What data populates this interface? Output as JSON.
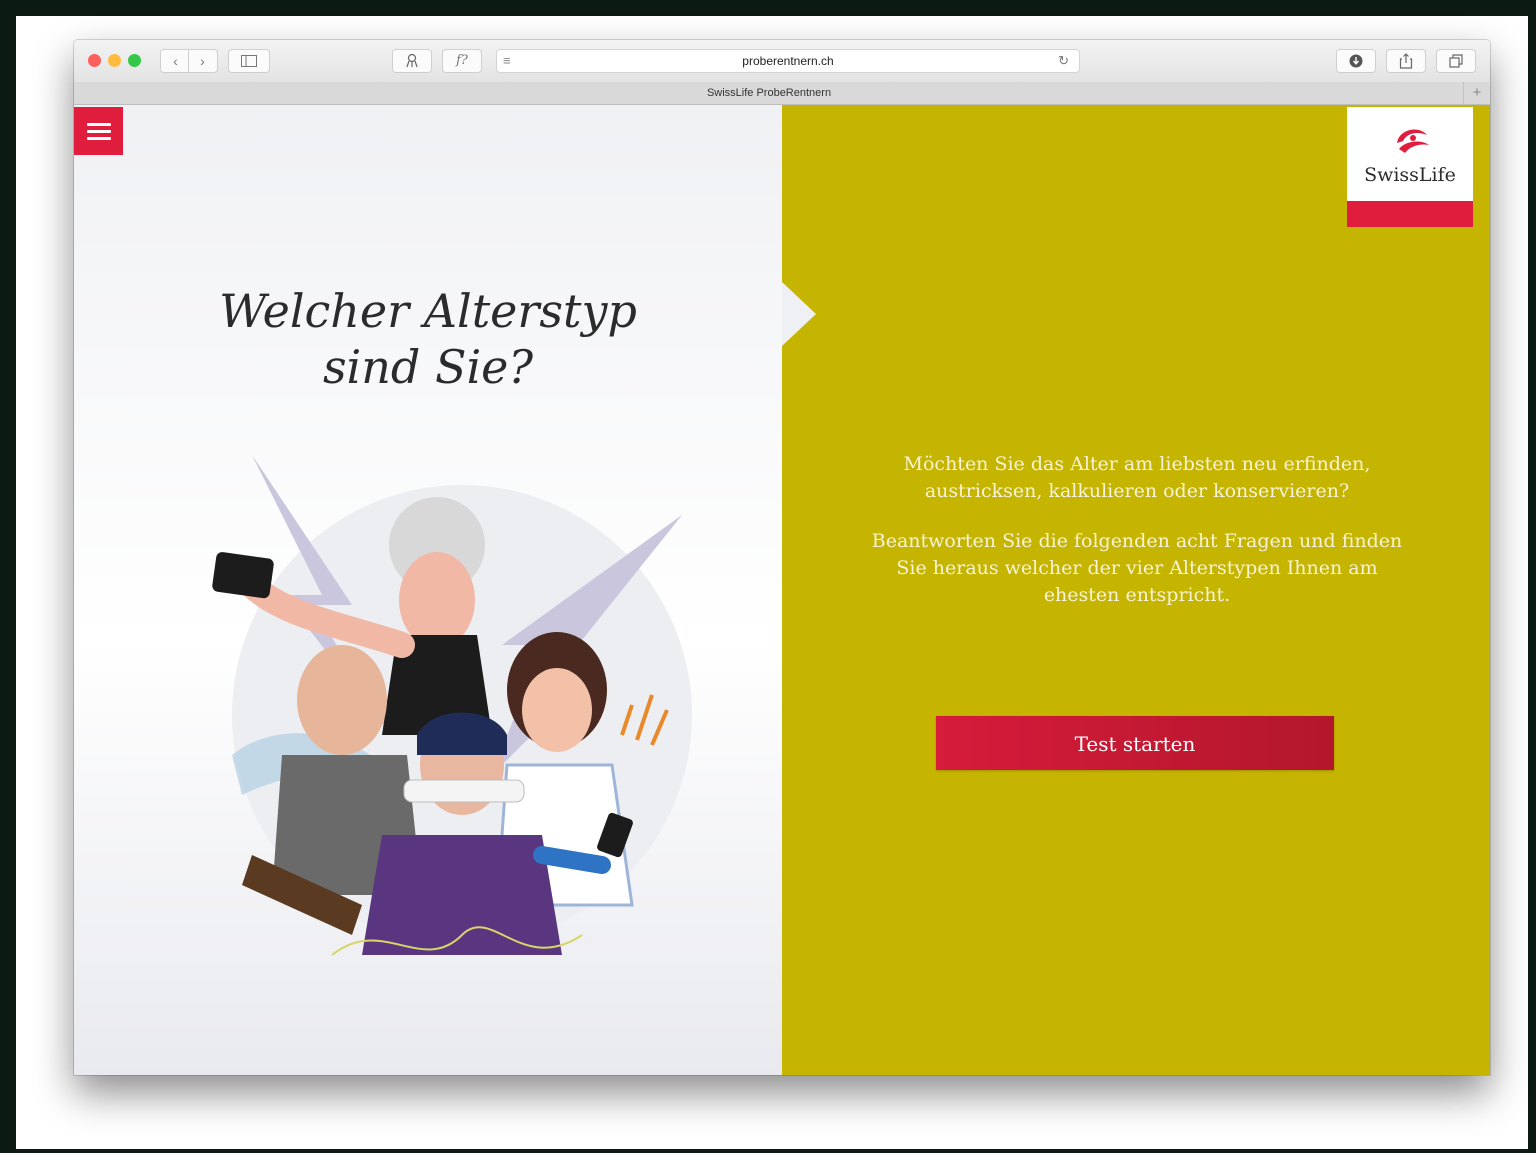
{
  "browser": {
    "address_url": "proberentnern.ch",
    "tab_title": "SwissLife ProbeRentnern",
    "new_tab_symbol": "+",
    "nav_back": "‹",
    "nav_forward": "›"
  },
  "page": {
    "headline_line1": "Welcher Alterstyp",
    "headline_line2": "sind Sie?",
    "intro_paragraph1": "Möchten Sie das Alter am liebsten neu erfinden, austricksen, kalkulieren oder konservieren?",
    "intro_paragraph2": "Beantworten Sie die folgenden acht Fragen und finden Sie heraus welcher der vier Alterstypen Ihnen am ehesten entspricht.",
    "cta_label": "Test starten",
    "logo_text": "SwissLife"
  },
  "colors": {
    "accent_red": "#e11d3d",
    "panel_olive": "#c5b400"
  },
  "icons": [
    "menu-icon",
    "back-icon",
    "forward-icon",
    "sidebar-icon",
    "bookmark-icon",
    "font-icon",
    "reader-icon",
    "reload-icon",
    "download-icon",
    "share-icon",
    "tabs-icon"
  ]
}
